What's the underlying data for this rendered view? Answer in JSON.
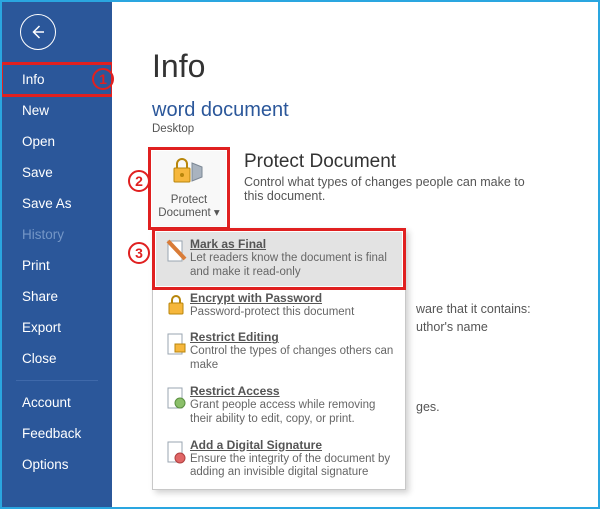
{
  "sidebar": {
    "items": [
      {
        "label": "Info",
        "selected": true
      },
      {
        "label": "New"
      },
      {
        "label": "Open"
      },
      {
        "label": "Save"
      },
      {
        "label": "Save As"
      },
      {
        "label": "History",
        "disabled": true
      },
      {
        "label": "Print"
      },
      {
        "label": "Share"
      },
      {
        "label": "Export"
      },
      {
        "label": "Close"
      }
    ],
    "bottom": [
      {
        "label": "Account"
      },
      {
        "label": "Feedback"
      },
      {
        "label": "Options"
      }
    ]
  },
  "main": {
    "heading": "Info",
    "doc_title": "word document",
    "doc_location": "Desktop",
    "protect": {
      "button_label": "Protect Document",
      "section_title": "Protect Document",
      "section_desc": "Control what types of changes people can make to this document."
    },
    "trail1": "ware that it contains:",
    "trail2": "uthor's name",
    "trail3": "ges."
  },
  "menu": {
    "items": [
      {
        "title": "Mark as Final",
        "sub": "Let readers know the document is final and make it read-only"
      },
      {
        "title": "Encrypt with Password",
        "sub": "Password-protect this document"
      },
      {
        "title": "Restrict Editing",
        "sub": "Control the types of changes others can make"
      },
      {
        "title": "Restrict Access",
        "sub": "Grant people access while removing their ability to edit, copy, or print."
      },
      {
        "title": "Add a Digital Signature",
        "sub": "Ensure the integrity of the document by adding an invisible digital signature"
      }
    ]
  },
  "annotations": {
    "a1": "1",
    "a2": "2",
    "a3": "3"
  }
}
